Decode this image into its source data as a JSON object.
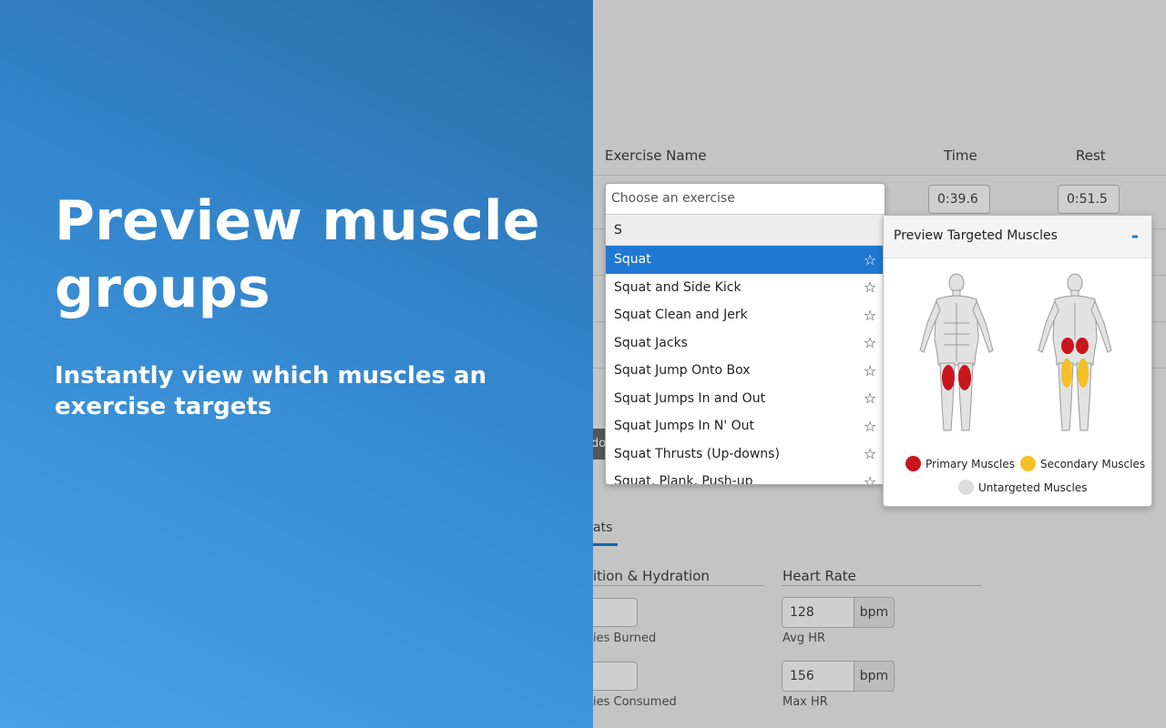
{
  "promo": {
    "title": "Preview muscle groups",
    "subtitle": "Instantly view which muscles an exercise targets"
  },
  "table": {
    "col_exercise": "Exercise Name",
    "col_time": "Time",
    "col_rest": "Rest",
    "time_value": "0:39.6",
    "rest_value": "0:51.5",
    "partial_button": "do"
  },
  "dropdown": {
    "placeholder": "Choose an exercise",
    "search_value": "S",
    "items": [
      {
        "label": "Squat"
      },
      {
        "label": "Squat and Side Kick"
      },
      {
        "label": "Squat Clean and Jerk"
      },
      {
        "label": "Squat Jacks"
      },
      {
        "label": "Squat Jump Onto Box"
      },
      {
        "label": "Squat Jumps In and Out"
      },
      {
        "label": "Squat Jumps In N' Out"
      },
      {
        "label": "Squat Thrusts (Up-downs)"
      },
      {
        "label": "Squat, Plank, Push-up"
      }
    ],
    "selected": "Squat",
    "favorite_icon": "star-outline-icon"
  },
  "preview": {
    "title": "Preview Targeted Muscles",
    "collapse_label": "-",
    "legend": {
      "primary": "Primary Muscles",
      "secondary": "Secondary Muscles",
      "untargeted": "Untargeted Muscles"
    },
    "colors": {
      "primary": "#c8161d",
      "secondary": "#f5c026",
      "untargeted": "#dcdcdc"
    }
  },
  "stats": {
    "tab_label": "ats",
    "nutrition_title": "ition & Hydration",
    "calories_burned_label": "ies Burned",
    "calories_consumed_label": "ies Consumed",
    "heart_rate_title": "Heart Rate",
    "avg_hr_value": "128",
    "avg_hr_unit": "bpm",
    "avg_hr_label": "Avg HR",
    "max_hr_value": "156",
    "max_hr_unit": "bpm",
    "max_hr_label": "Max HR"
  },
  "colors": {
    "accent": "#1f78d1",
    "promo_gradient_start": "#2a6fa8",
    "promo_gradient_end": "#47a2e6"
  }
}
